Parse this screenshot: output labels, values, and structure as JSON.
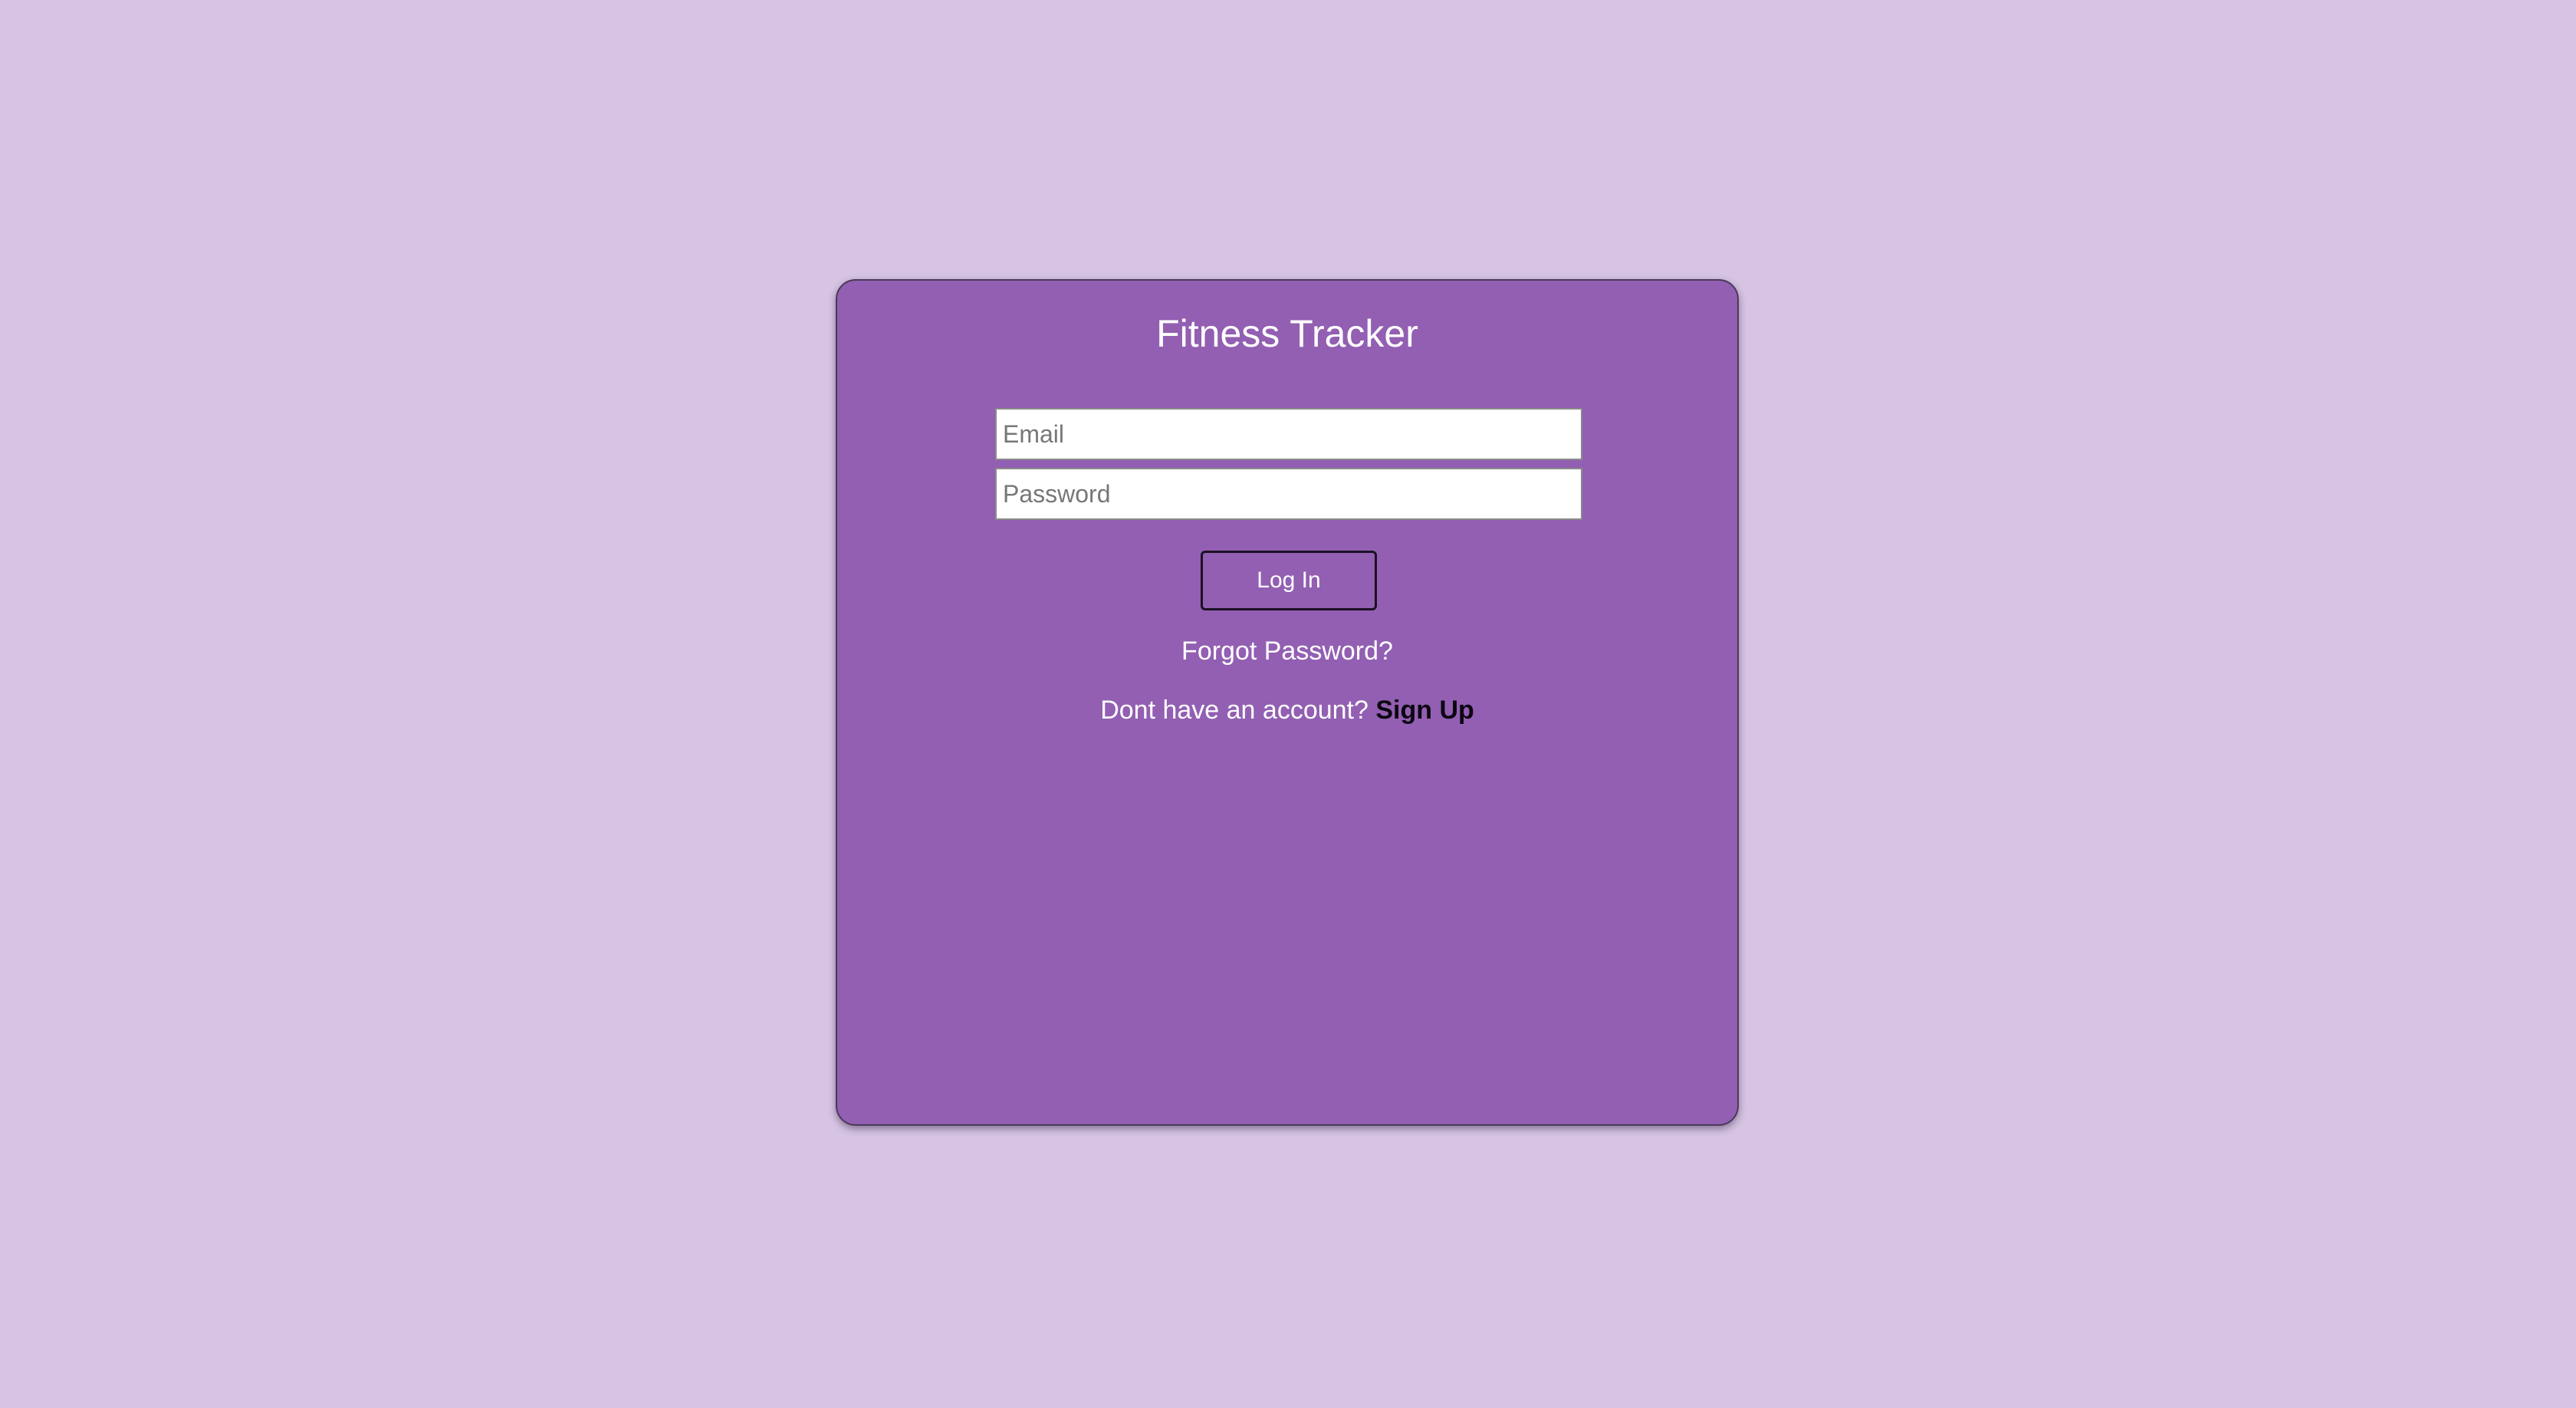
{
  "app": {
    "title": "Fitness Tracker"
  },
  "login_form": {
    "email": {
      "placeholder": "Email",
      "value": ""
    },
    "password": {
      "placeholder": "Password",
      "value": ""
    },
    "login_label": "Log In",
    "forgot_password_label": "Forgot Password?",
    "no_account_text": "Dont have an account? ",
    "sign_up_label": "Sign Up"
  },
  "colors": {
    "page_background": "#d6c4e2",
    "card_background": "#925fb2",
    "text": "#ffffff",
    "link_emphasis": "#0b0610"
  }
}
